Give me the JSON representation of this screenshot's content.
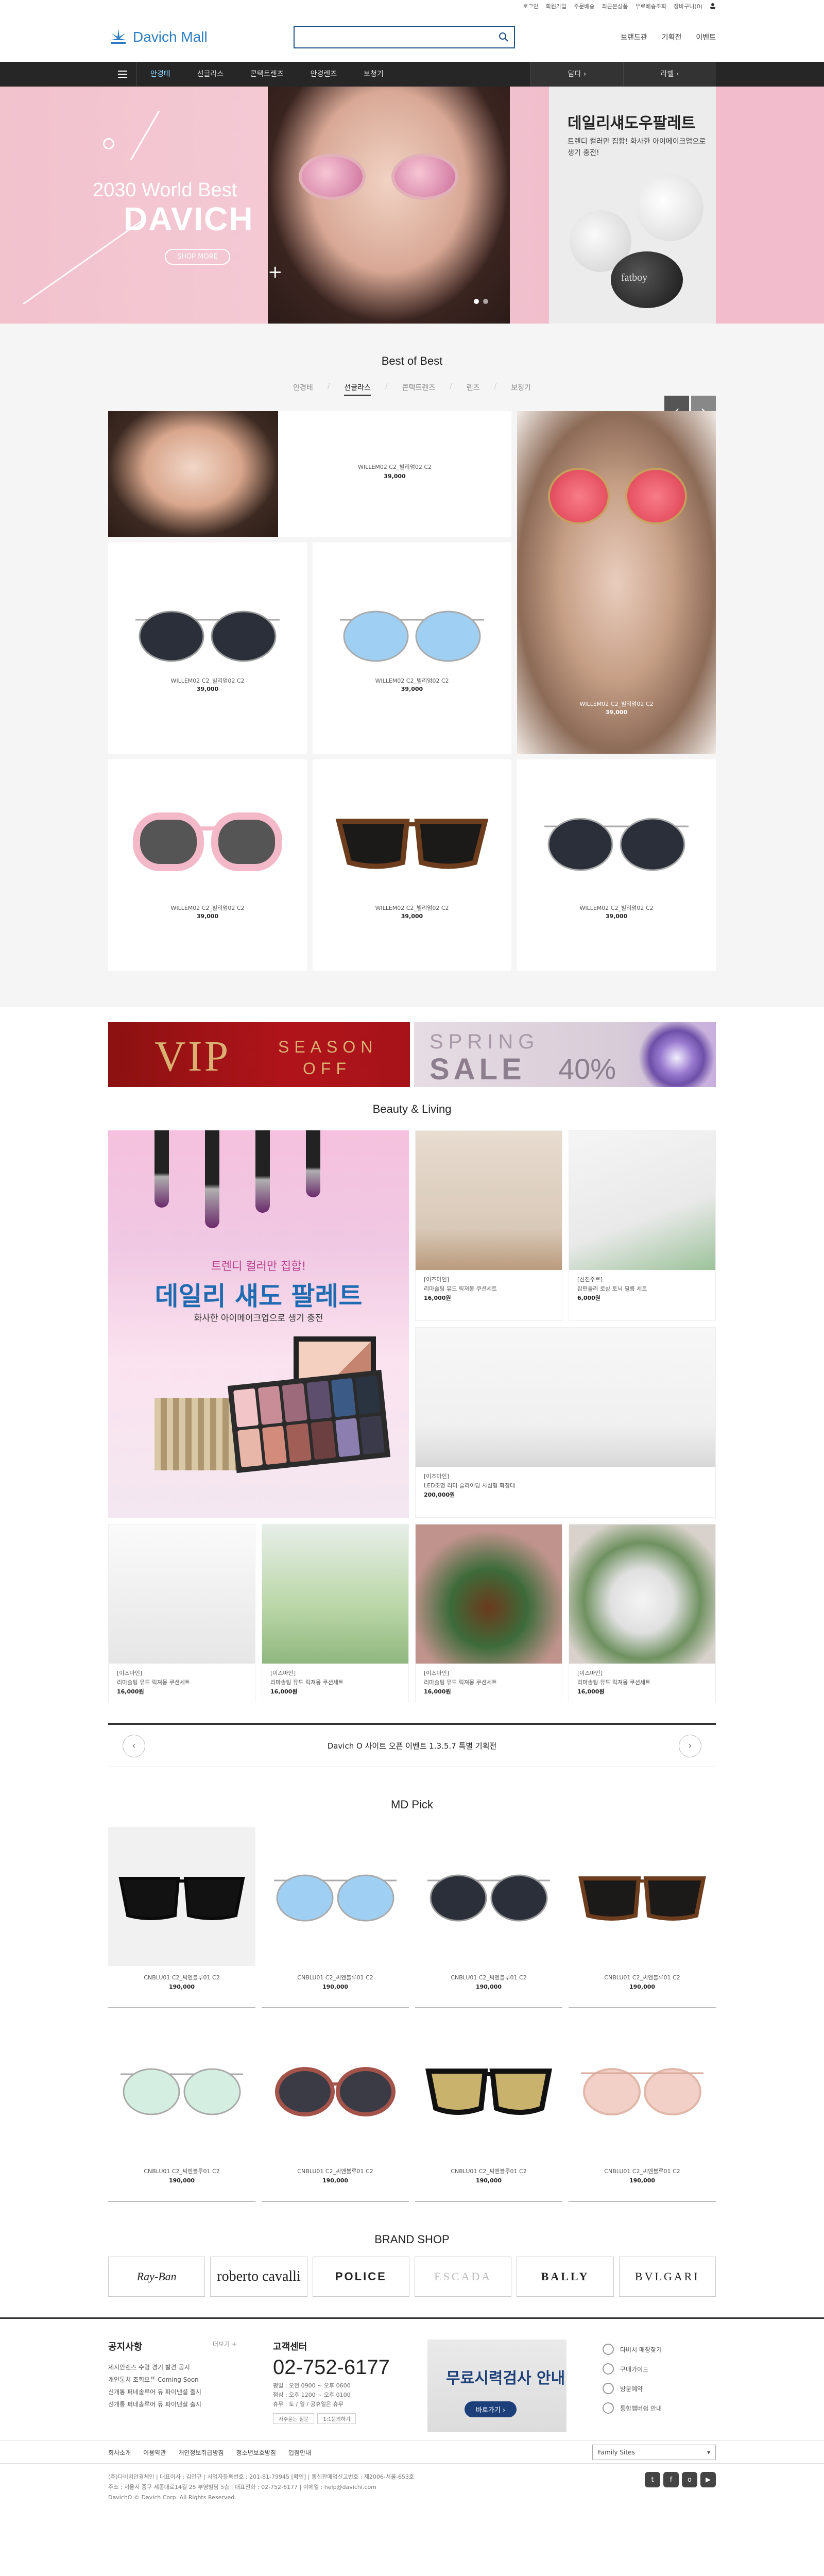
{
  "util": [
    "로그인",
    "회원가입",
    "주문배송",
    "최근본상품",
    "무료배송조회",
    "장바구니(0)"
  ],
  "logo": "Davich Mall",
  "search": {
    "placeholder": ""
  },
  "header_links": [
    "브랜드관",
    "기획전",
    "이벤트"
  ],
  "gnb": {
    "items": [
      "안경테",
      "선글라스",
      "콘택트렌즈",
      "안경렌즈",
      "보청기"
    ],
    "right": [
      "담다 ›",
      "라벨 ›"
    ]
  },
  "hero": {
    "subtitle": "2030 World Best",
    "title": "DAVICH",
    "cta": "SHOP MORE",
    "panel_title": "데일리섀도우팔레트",
    "panel_sub": "트렌디 컬러만 집합! 화사한 아이메이크업으로 생기 충전!",
    "panel_brand": "fatboy"
  },
  "best": {
    "title": "Best of Best",
    "tabs": [
      "안경테",
      "선글라스",
      "콘택트렌즈",
      "렌즈",
      "보청기"
    ],
    "items": [
      {
        "name": "WILLEM02 C2_빌리엄02 C2",
        "price": "39,000"
      },
      {
        "name": "WILLEM02 C2_빌리엄02 C2",
        "price": "39,000"
      },
      {
        "name": "WILLEM02 C2_빌리엄02 C2",
        "price": "39,000"
      },
      {
        "name": "WILLEM02 C2_빌리엄02 C2",
        "price": "39,000"
      },
      {
        "name": "WILLEM02 C2_빌리엄02 C2",
        "price": "39,000"
      },
      {
        "name": "WILLEM02 C2_빌리엄02 C2",
        "price": "39,000"
      },
      {
        "name": "WILLEM02 C2_빌리엄02 C2",
        "price": "39,000"
      }
    ]
  },
  "banners": {
    "vip": "VIP",
    "season": "SEASON",
    "off": "OFF",
    "spring": "SPRING",
    "sale": "SALE",
    "pct": "40%"
  },
  "beauty": {
    "title": "Beauty & Living",
    "feature_line1": "트렌디 컬러만 집합!",
    "feature_line2": "데일리 섀도 팔레트",
    "feature_line3": "화사한 아이메이크업으로 생기 충전",
    "cards": [
      {
        "cat": "[이즈마인]",
        "name": "리마솔팅 뮤드 릭져몽 쿠션세트",
        "price": "16,000원"
      },
      {
        "cat": "[신진주르]",
        "name": "잡편들러 로상 토닉 필름 세트",
        "price": "6,000원"
      },
      {
        "cat": "[이즈마인]",
        "name": "LED조명 리미 슬라이딩 사심형 화장대",
        "price": "200,000원"
      },
      {
        "cat": "[이즈마인]",
        "name": "리마솔팅 뮤드 릭져몽 쿠션세트",
        "price": "16,000원"
      },
      {
        "cat": "[이즈마인]",
        "name": "리마솔팅 뮤드 릭져몽 쿠션세트",
        "price": "16,000원"
      },
      {
        "cat": "[이즈마인]",
        "name": "리마솔팅 뮤드 릭져몽 쿠션세트",
        "price": "16,000원"
      },
      {
        "cat": "[이즈마인]",
        "name": "리마솔팅 뮤드 릭져몽 쿠션세트",
        "price": "16,000원"
      }
    ]
  },
  "notice": "Davich O 사이트 오픈 이벤트 1.3.5.7 특별 기획전",
  "md": {
    "title": "MD Pick",
    "items": [
      {
        "name": "CNBLU01 C2_씨엔블루01 C2",
        "price": "190,000"
      },
      {
        "name": "CNBLU01 C2_씨엔블루01 C2",
        "price": "190,000"
      },
      {
        "name": "CNBLU01 C2_씨엔블루01 C2",
        "price": "190,000"
      },
      {
        "name": "CNBLU01 C2_씨엔블루01 C2",
        "price": "190,000"
      },
      {
        "name": "CNBLU01 C2_씨엔블루01 C2",
        "price": "190,000"
      },
      {
        "name": "CNBLU01 C2_씨엔블루01 C2",
        "price": "190,000"
      },
      {
        "name": "CNBLU01 C2_씨엔블루01 C2",
        "price": "190,000"
      },
      {
        "name": "CNBLU01 C2_씨엔블루01 C2",
        "price": "190,000"
      }
    ]
  },
  "brand": {
    "title": "BRAND SHOP",
    "items": [
      "Ray-Ban",
      "roberto cavalli",
      "POLICE",
      "ESCADA",
      "BALLY",
      "BVLGARI"
    ]
  },
  "footer": {
    "notice_title": "공지사항",
    "notice_more": "더보기 +",
    "notices": [
      "제시안렌즈 수령 경기 발견 공지",
      "개인통치 조회오픈 Coming Soon",
      "신개통 퍼네솔루어 듀 파이낸셜 출시",
      "신개통 퍼네솔루어 듀 파이낸셜 출시"
    ],
    "cs_title": "고객센터",
    "tel": "02-752-6177",
    "hours": [
      "평일 : 오전 0900 ~ 오후 0600",
      "점심 : 오후 1200 ~ 오후 0100",
      "휴무 : 토 / 일 / 공휴일은 휴무"
    ],
    "cs_buttons": [
      "자주묻는 질문",
      "1:1문의하기"
    ],
    "eye_title": "무료시력검사 안내",
    "eye_btn": "바로가기 ›",
    "links": [
      "다비치 매장찾기",
      "구매가이드",
      "방문예약",
      "통합멤버쉽 안내"
    ],
    "bar": [
      "회사소개",
      "이용약관",
      "개인정보취급방침",
      "청소년보호방침",
      "입점안내"
    ],
    "family": "Family Sites",
    "addr1": "(주)다비치안경체인  |  대표이사 : 김인규  |  사업자등록번호 : 201-81-79945 [확인]  |  통신판매업신고번호 : 제2006-서울-653호",
    "addr2": "주소 : 서울시 중구 세종대로14길 25 부영빌딩 5층  |  대표전화 : 02-752-6177  |  이메일 : help@davichi.com",
    "copy": "DavichO © Davich Corp. All Rights Reserved.",
    "sns": [
      "t",
      "f",
      "o",
      "▶"
    ]
  }
}
